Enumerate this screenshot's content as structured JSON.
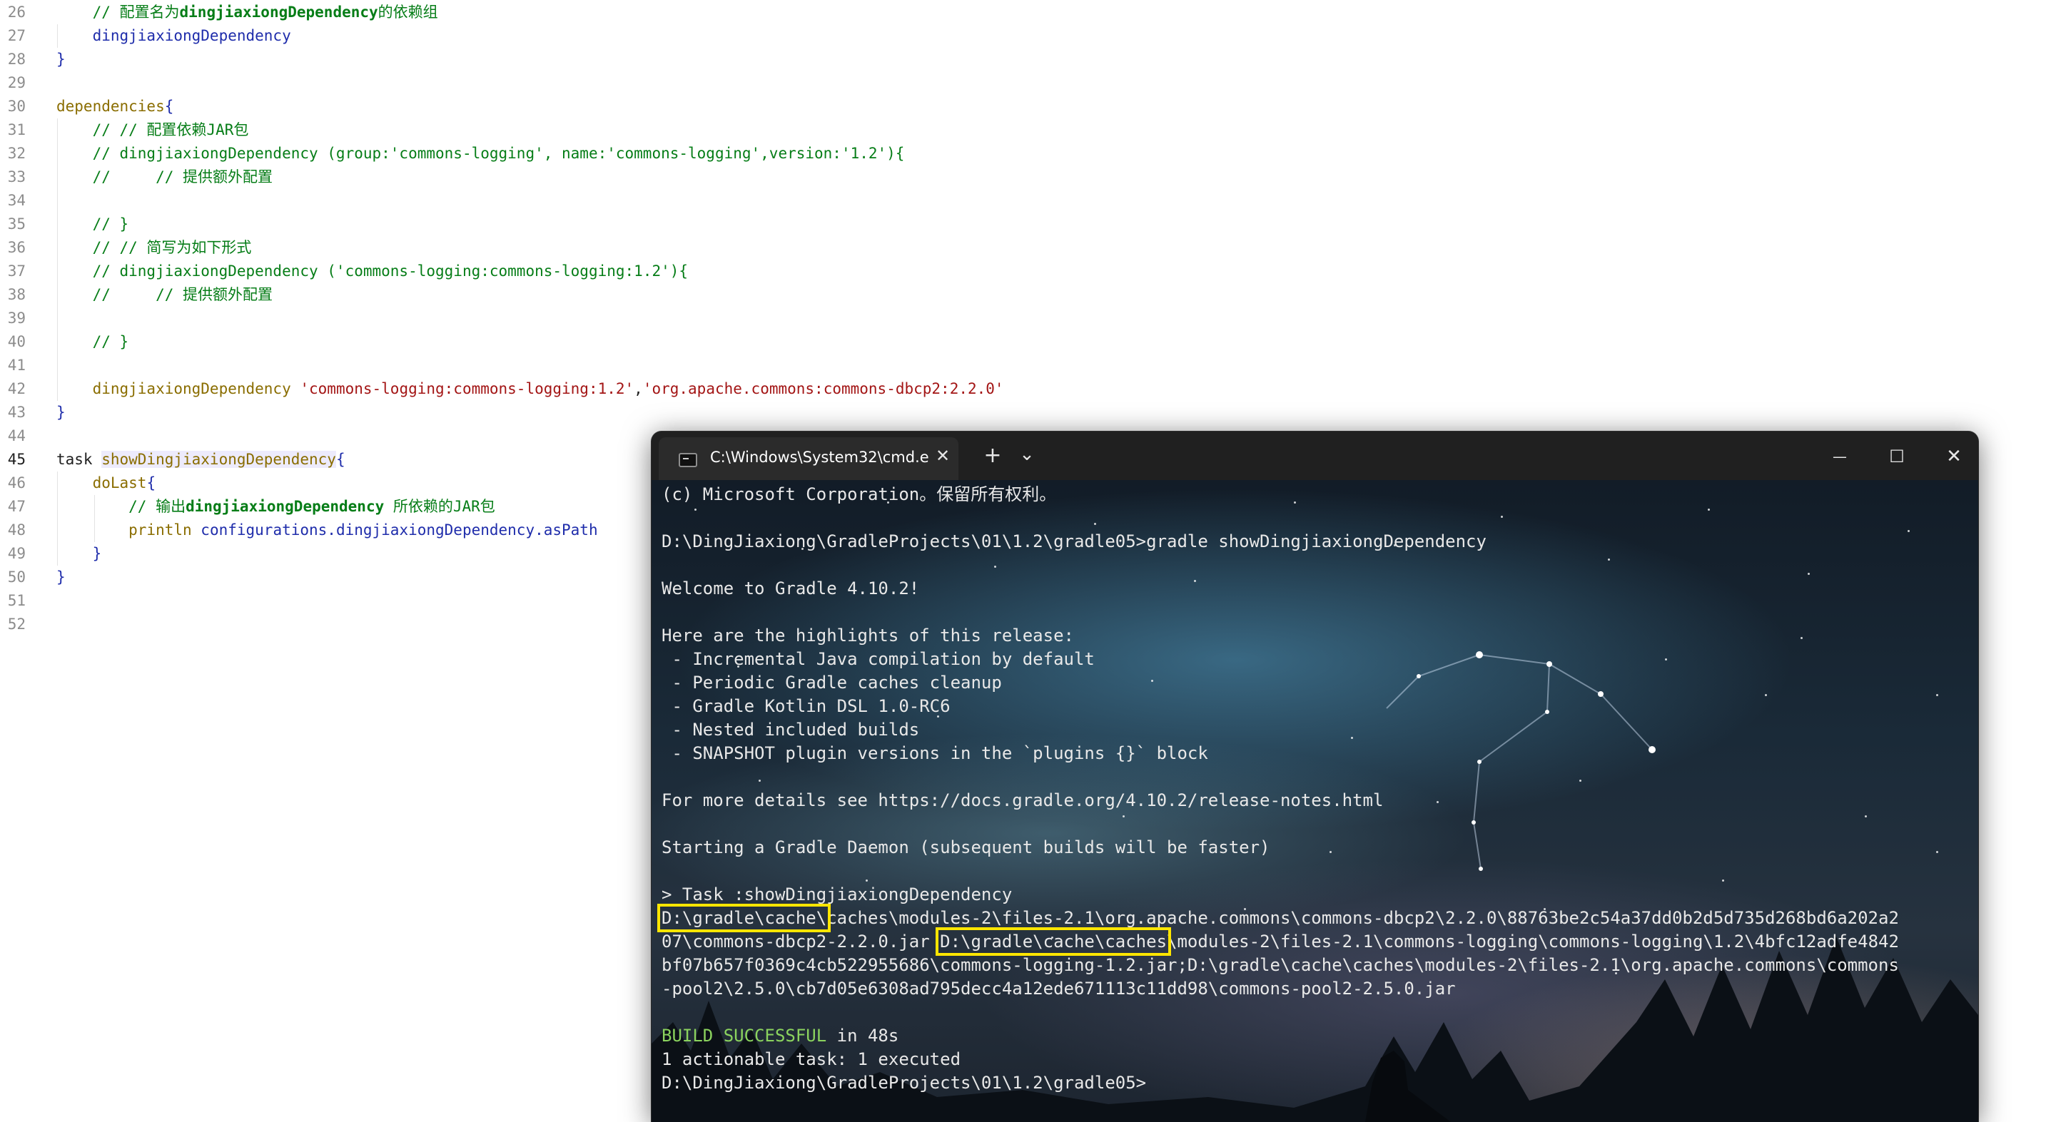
{
  "editor": {
    "active_line": "45",
    "lines": [
      {
        "n": "26",
        "segs": [
          {
            "t": "    // 配置名为",
            "c": "#067d17"
          },
          {
            "t": "dingjiaxiongDependency",
            "c": "#067d17",
            "b": true
          },
          {
            "t": "的依赖组",
            "c": "#067d17"
          }
        ]
      },
      {
        "n": "27",
        "segs": [
          {
            "t": "    dingjiaxiongDependency",
            "c": "#1f2dab"
          }
        ]
      },
      {
        "n": "28",
        "segs": [
          {
            "t": "}",
            "c": "#1f2dab"
          }
        ]
      },
      {
        "n": "29",
        "segs": []
      },
      {
        "n": "30",
        "segs": [
          {
            "t": "dependencies",
            "c": "#8a6d00"
          },
          {
            "t": "{",
            "c": "#1f2dab"
          }
        ]
      },
      {
        "n": "31",
        "segs": [
          {
            "t": "    // // 配置依赖JAR包",
            "c": "#067d17"
          }
        ]
      },
      {
        "n": "32",
        "segs": [
          {
            "t": "    // dingjiaxiongDependency (group:'commons-logging', name:'commons-logging',version:'1.2'){",
            "c": "#067d17"
          }
        ]
      },
      {
        "n": "33",
        "segs": [
          {
            "t": "    //     // 提供额外配置",
            "c": "#067d17"
          }
        ]
      },
      {
        "n": "34",
        "segs": []
      },
      {
        "n": "35",
        "segs": [
          {
            "t": "    // }",
            "c": "#067d17"
          }
        ]
      },
      {
        "n": "36",
        "segs": [
          {
            "t": "    // // 简写为如下形式",
            "c": "#067d17"
          }
        ]
      },
      {
        "n": "37",
        "segs": [
          {
            "t": "    // dingjiaxiongDependency ('commons-logging:commons-logging:1.2'){",
            "c": "#067d17"
          }
        ]
      },
      {
        "n": "38",
        "segs": [
          {
            "t": "    //     // 提供额外配置",
            "c": "#067d17"
          }
        ]
      },
      {
        "n": "39",
        "segs": []
      },
      {
        "n": "40",
        "segs": [
          {
            "t": "    // }",
            "c": "#067d17"
          }
        ]
      },
      {
        "n": "41",
        "segs": []
      },
      {
        "n": "42",
        "segs": [
          {
            "t": "    dingjiaxiongDependency ",
            "c": "#8a6d00"
          },
          {
            "t": "'commons-logging:commons-logging:1.2'",
            "c": "#a31515"
          },
          {
            "t": ",",
            "c": "#1f1f1f"
          },
          {
            "t": "'org.apache.commons:commons-dbcp2:2.2.0'",
            "c": "#a31515"
          }
        ]
      },
      {
        "n": "43",
        "segs": [
          {
            "t": "}",
            "c": "#1f2dab"
          }
        ]
      },
      {
        "n": "44",
        "segs": []
      },
      {
        "n": "45",
        "segs": [
          {
            "t": "task ",
            "c": "#1f1f1f"
          },
          {
            "t": "showDingjiaxiongDependency",
            "c": "#8a6d00",
            "bg": "#edebfc"
          },
          {
            "t": "{",
            "c": "#1f2dab"
          }
        ]
      },
      {
        "n": "46",
        "segs": [
          {
            "t": "    doLast",
            "c": "#8a6d00"
          },
          {
            "t": "{",
            "c": "#1f2dab"
          }
        ]
      },
      {
        "n": "47",
        "segs": [
          {
            "t": "        // 输出",
            "c": "#067d17"
          },
          {
            "t": "dingjiaxiongDependency",
            "c": "#067d17",
            "b": true
          },
          {
            "t": " 所依赖的JAR包",
            "c": "#067d17"
          }
        ]
      },
      {
        "n": "48",
        "segs": [
          {
            "t": "        println ",
            "c": "#8a6d00"
          },
          {
            "t": "configurations.dingjiaxiongDependency.asPath",
            "c": "#1f2dab"
          }
        ]
      },
      {
        "n": "49",
        "segs": [
          {
            "t": "    }",
            "c": "#1f2dab"
          }
        ]
      },
      {
        "n": "50",
        "segs": [
          {
            "t": "}",
            "c": "#1f2dab"
          }
        ]
      },
      {
        "n": "51",
        "segs": []
      },
      {
        "n": "52",
        "segs": []
      }
    ]
  },
  "terminal": {
    "tab_title": "C:\\Windows\\System32\\cmd.e",
    "tab_close": "✕",
    "new_tab": "+",
    "dropdown": "⌄",
    "minimize": "—",
    "maximize": "☐",
    "close": "✕",
    "lines": [
      {
        "segs": [
          {
            "t": "(c) Microsoft Corporation。保留所有权利。"
          }
        ]
      },
      {
        "segs": []
      },
      {
        "segs": [
          {
            "t": "D:\\DingJiaxiong\\GradleProjects\\01\\1.2\\gradle05>gradle showDingjiaxiongDependency"
          }
        ]
      },
      {
        "segs": []
      },
      {
        "segs": [
          {
            "t": "Welcome to Gradle 4.10.2!"
          }
        ]
      },
      {
        "segs": []
      },
      {
        "segs": [
          {
            "t": "Here are the highlights of this release:"
          }
        ]
      },
      {
        "segs": [
          {
            "t": " - Incremental Java compilation by default"
          }
        ]
      },
      {
        "segs": [
          {
            "t": " - Periodic Gradle caches cleanup"
          }
        ]
      },
      {
        "segs": [
          {
            "t": " - Gradle Kotlin DSL 1.0-RC6"
          }
        ]
      },
      {
        "segs": [
          {
            "t": " - Nested included builds"
          }
        ]
      },
      {
        "segs": [
          {
            "t": " - SNAPSHOT plugin versions in the `plugins {}` block"
          }
        ]
      },
      {
        "segs": []
      },
      {
        "segs": [
          {
            "t": "For more details see https://docs.gradle.org/4.10.2/release-notes.html"
          }
        ]
      },
      {
        "segs": []
      },
      {
        "segs": [
          {
            "t": "Starting a Gradle Daemon (subsequent builds will be faster)"
          }
        ]
      },
      {
        "segs": []
      },
      {
        "segs": [
          {
            "t": "> Task :showDingjiaxiongDependency"
          }
        ]
      },
      {
        "segs": [
          {
            "t": "D:\\gradle\\cache\\",
            "hl": true
          },
          {
            "t": "caches\\modules-2\\files-2.1\\org.apache.commons\\commons-dbcp2\\2.2.0\\88763be2c54a37dd0b2d5d735d268bd6a202a2"
          }
        ]
      },
      {
        "segs": [
          {
            "t": "07\\commons-dbcp2-2.2.0.jar "
          },
          {
            "t": "D:\\gradle\\cache\\caches",
            "hl": true
          },
          {
            "t": "\\modules-2\\files-2.1\\commons-logging\\commons-logging\\1.2\\4bfc12adfe4842"
          }
        ]
      },
      {
        "segs": [
          {
            "t": "bf07b657f0369c4cb522955686\\commons-logging-1.2.jar;D:\\gradle\\cache\\caches\\modules-2\\files-2.1\\org.apache.commons\\commons"
          }
        ]
      },
      {
        "segs": [
          {
            "t": "-pool2\\2.5.0\\cb7d05e6308ad795decc4a12ede671113c11dd98\\commons-pool2-2.5.0.jar"
          }
        ]
      },
      {
        "segs": []
      },
      {
        "segs": [
          {
            "t": "BUILD SUCCESSFUL",
            "green": true
          },
          {
            "t": " in 48s"
          }
        ]
      },
      {
        "segs": [
          {
            "t": "1 actionable task: 1 executed"
          }
        ]
      },
      {
        "segs": [
          {
            "t": "D:\\DingJiaxiong\\GradleProjects\\01\\1.2\\gradle05>"
          }
        ]
      }
    ]
  }
}
